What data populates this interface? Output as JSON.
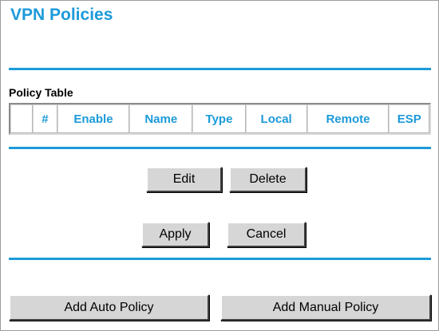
{
  "page": {
    "title": "VPN Policies"
  },
  "policy_table": {
    "label": "Policy Table",
    "columns": [
      "",
      "#",
      "Enable",
      "Name",
      "Type",
      "Local",
      "Remote",
      "ESP"
    ]
  },
  "actions": {
    "edit_label": "Edit",
    "delete_label": "Delete",
    "apply_label": "Apply",
    "cancel_label": "Cancel",
    "add_auto_label": "Add Auto Policy",
    "add_manual_label": "Add Manual Policy"
  },
  "colors": {
    "accent": "#1c9ad9",
    "button_face": "#d6d6d6"
  }
}
